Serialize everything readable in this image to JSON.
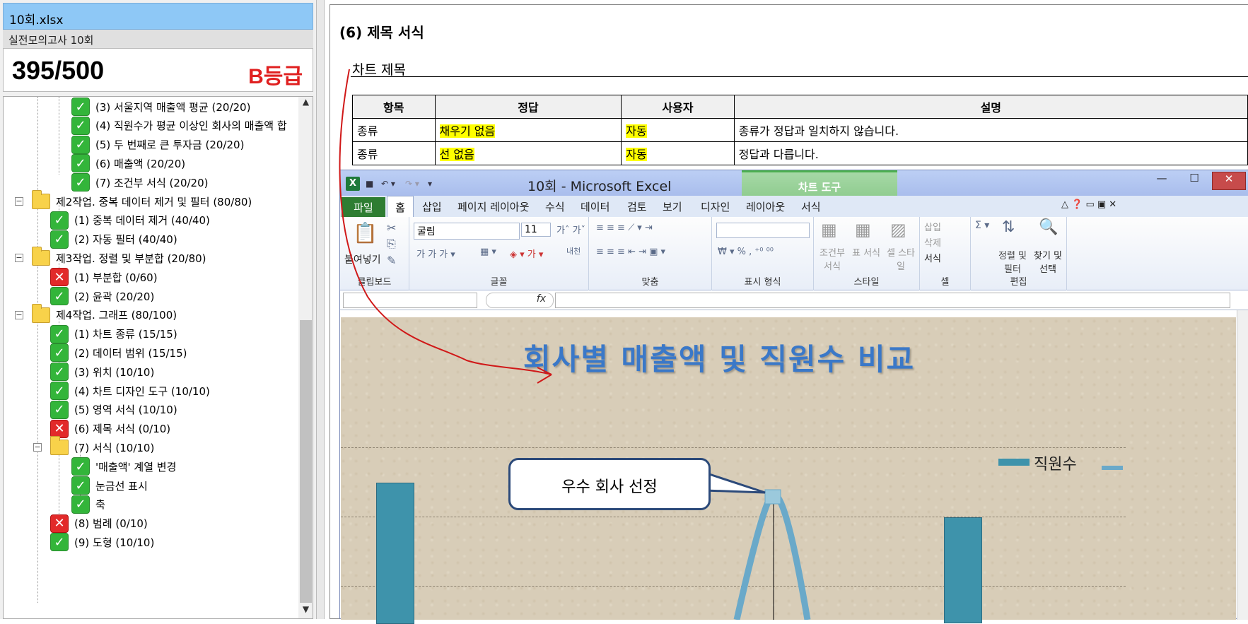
{
  "sidebar": {
    "file_title": "10회.xlsx",
    "exam_name": "실전모의고사 10회",
    "score": "395/500",
    "grade": "B등급",
    "tree": [
      {
        "label": "(3) 서울지역 매출액 평균 (20/20)",
        "status": "pass"
      },
      {
        "label": "(4) 직원수가 평균 이상인 회사의 매출액 합",
        "status": "pass"
      },
      {
        "label": "(5) 두 번째로 큰 투자금 (20/20)",
        "status": "pass"
      },
      {
        "label": "(6) 매출액 (20/20)",
        "status": "pass"
      },
      {
        "label": "(7) 조건부 서식 (20/20)",
        "status": "pass"
      },
      {
        "label": "제2작업. 중복 데이터 제거 및 필터 (80/80)",
        "status": "folder"
      },
      {
        "label": "(1) 중복 데이터 제거 (40/40)",
        "status": "pass"
      },
      {
        "label": "(2) 자동 필터 (40/40)",
        "status": "pass"
      },
      {
        "label": "제3작업. 정렬 및 부분합 (20/80)",
        "status": "folder"
      },
      {
        "label": "(1) 부분합 (0/60)",
        "status": "fail"
      },
      {
        "label": "(2) 윤곽 (20/20)",
        "status": "pass"
      },
      {
        "label": "제4작업. 그래프 (80/100)",
        "status": "folder"
      },
      {
        "label": "(1) 차트 종류 (15/15)",
        "status": "pass"
      },
      {
        "label": "(2) 데이터 범위 (15/15)",
        "status": "pass"
      },
      {
        "label": "(3) 위치 (10/10)",
        "status": "pass"
      },
      {
        "label": "(4) 차트 디자인 도구 (10/10)",
        "status": "pass"
      },
      {
        "label": "(5) 영역 서식 (10/10)",
        "status": "pass"
      },
      {
        "label": "(6) 제목 서식 (0/10)",
        "status": "fail"
      },
      {
        "label": "(7) 서식 (10/10)",
        "status": "folder-pass"
      },
      {
        "label": "'매출액' 계열 변경",
        "status": "pass"
      },
      {
        "label": "눈금선 표시",
        "status": "pass"
      },
      {
        "label": "축",
        "status": "pass"
      },
      {
        "label": "(8) 범례 (0/10)",
        "status": "fail"
      },
      {
        "label": "(9) 도형 (10/10)",
        "status": "pass"
      }
    ]
  },
  "detail": {
    "section_title": "(6) 제목 서식",
    "sub_title": "차트 제목",
    "headers": [
      "항목",
      "정답",
      "사용자",
      "설명"
    ],
    "rows": [
      [
        "종류",
        "채우기 없음",
        "자동",
        "종류가 정답과 일치하지 않습니다."
      ],
      [
        "종류",
        "선 없음",
        "자동",
        "정답과 다릅니다."
      ]
    ]
  },
  "excel": {
    "window_title": "10회  -  Microsoft Excel",
    "chart_tools": "차트 도구",
    "tabs": [
      "파일",
      "홈",
      "삽입",
      "페이지 레이아웃",
      "수식",
      "데이터",
      "검토",
      "보기",
      "디자인",
      "레이아웃",
      "서식"
    ],
    "ribbon": {
      "paste": "붙여넣기",
      "font_name": "굴림",
      "font_size": "11",
      "groups": [
        "클립보드",
        "글꼴",
        "맞춤",
        "표시 형식",
        "스타일",
        "셀",
        "편집"
      ],
      "cond_format": "조건부 서식",
      "table_format": "표 서식",
      "cell_style": "셀 스타일",
      "insert": "삽입",
      "delete": "삭제",
      "format": "서식",
      "sort_filter": "정렬 및 필터",
      "find_select": "찾기 및 선택"
    },
    "formula_bar": {
      "fx": "fx"
    },
    "chart": {
      "title": "회사별 매출액 및 직원수 비교",
      "legend": "직원수",
      "callout": "우수 회사 선정"
    }
  },
  "colors": {
    "accent": "#3a78c8",
    "bar": "#3e93ab",
    "fail": "#e22a2a",
    "pass": "#33b53a"
  }
}
